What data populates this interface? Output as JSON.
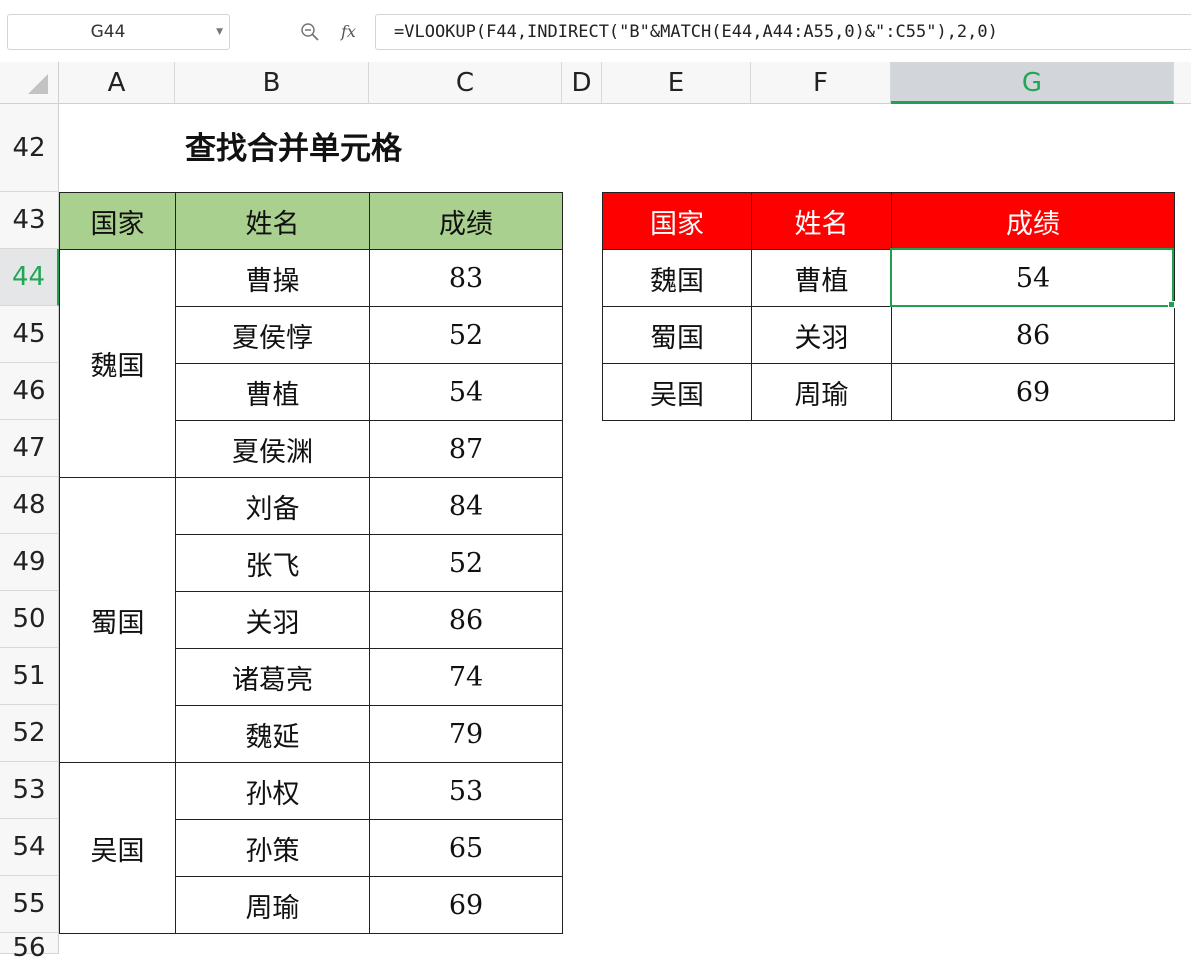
{
  "formula_bar": {
    "name_box": "G44",
    "fx": "fx",
    "formula": "=VLOOKUP(F44,INDIRECT(\"B\"&MATCH(E44,A44:A55,0)&\":C55\"),2,0)"
  },
  "columns": [
    "A",
    "B",
    "C",
    "D",
    "E",
    "F",
    "G"
  ],
  "active_column": "G",
  "rows": [
    "42",
    "43",
    "44",
    "45",
    "46",
    "47",
    "48",
    "49",
    "50",
    "51",
    "52",
    "53",
    "54",
    "55",
    "56"
  ],
  "active_row": "44",
  "sheet": {
    "title": "查找合并单元格",
    "left_table": {
      "headers": [
        "国家",
        "姓名",
        "成绩"
      ],
      "groups": [
        {
          "country": "魏国",
          "members": [
            {
              "name": "曹操",
              "score": "83"
            },
            {
              "name": "夏侯惇",
              "score": "52"
            },
            {
              "name": "曹植",
              "score": "54"
            },
            {
              "name": "夏侯渊",
              "score": "87"
            }
          ]
        },
        {
          "country": "蜀国",
          "members": [
            {
              "name": "刘备",
              "score": "84"
            },
            {
              "name": "张飞",
              "score": "52"
            },
            {
              "name": "关羽",
              "score": "86"
            },
            {
              "name": "诸葛亮",
              "score": "74"
            },
            {
              "name": "魏延",
              "score": "79"
            }
          ]
        },
        {
          "country": "吴国",
          "members": [
            {
              "name": "孙权",
              "score": "53"
            },
            {
              "name": "孙策",
              "score": "65"
            },
            {
              "name": "周瑜",
              "score": "69"
            }
          ]
        }
      ]
    },
    "right_table": {
      "headers": [
        "国家",
        "姓名",
        "成绩"
      ],
      "rows": [
        {
          "country": "魏国",
          "name": "曹植",
          "score": "54"
        },
        {
          "country": "蜀国",
          "name": "关羽",
          "score": "86"
        },
        {
          "country": "吴国",
          "name": "周瑜",
          "score": "69"
        }
      ]
    }
  },
  "colors": {
    "header_green": "#a9d08e",
    "header_red": "#ff0000",
    "selection": "#21a04f"
  }
}
